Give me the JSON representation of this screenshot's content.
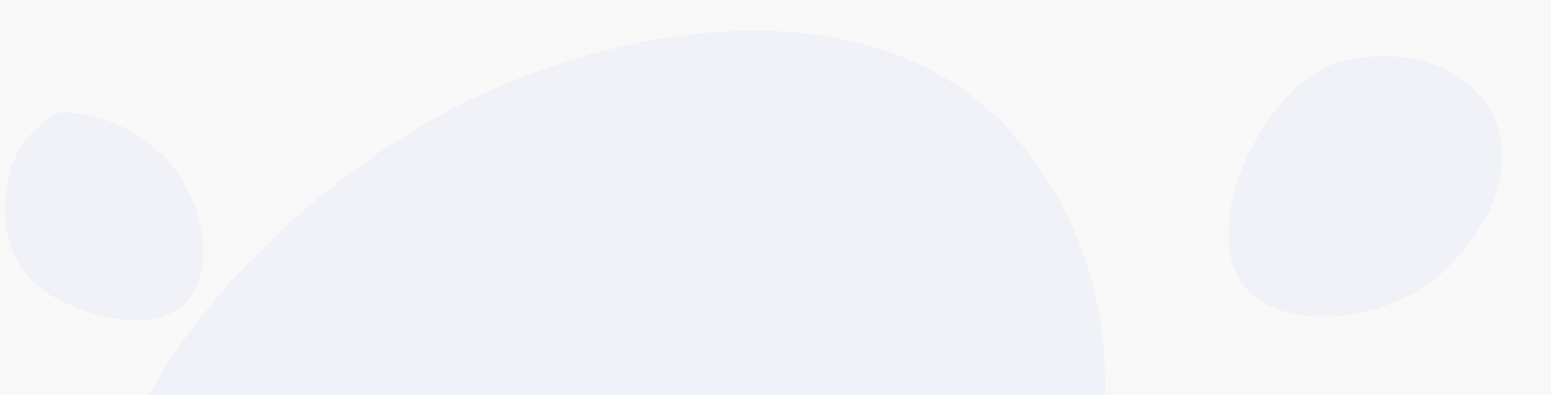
{
  "colors": {
    "background": "#f8f8f8",
    "blob_fill": "#f1f2f7"
  }
}
